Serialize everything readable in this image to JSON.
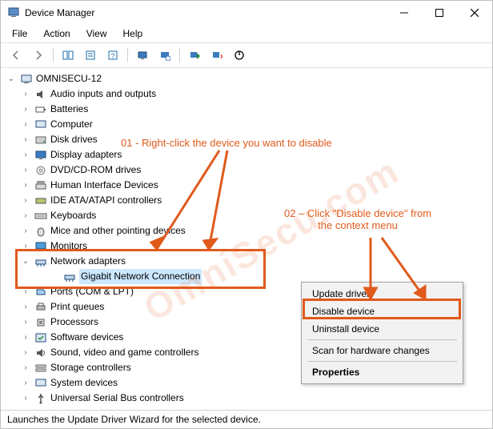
{
  "title": "Device Manager",
  "menu": {
    "file": "File",
    "action": "Action",
    "view": "View",
    "help": "Help"
  },
  "root": "OMNISECU-12",
  "categories": [
    "Audio inputs and outputs",
    "Batteries",
    "Computer",
    "Disk drives",
    "Display adapters",
    "DVD/CD-ROM drives",
    "Human Interface Devices",
    "IDE ATA/ATAPI controllers",
    "Keyboards",
    "Mice and other pointing devices",
    "Monitors",
    "Network adapters",
    "Ports (COM & LPT)",
    "Print queues",
    "Processors",
    "Software devices",
    "Sound, video and game controllers",
    "Storage controllers",
    "System devices",
    "Universal Serial Bus controllers"
  ],
  "selected_device": "Gigabit Network Connection",
  "context_menu": {
    "update": "Update driver",
    "disable": "Disable device",
    "uninstall": "Uninstall device",
    "scan": "Scan for hardware changes",
    "properties": "Properties"
  },
  "statusbar": "Launches the Update Driver Wizard for the selected device.",
  "annotation": {
    "one": "01 - Right-click the device you want to disable",
    "two_a": "02 – Click \"Disable device\" from",
    "two_b": "the context menu"
  },
  "watermark": "OmniSecu.com"
}
